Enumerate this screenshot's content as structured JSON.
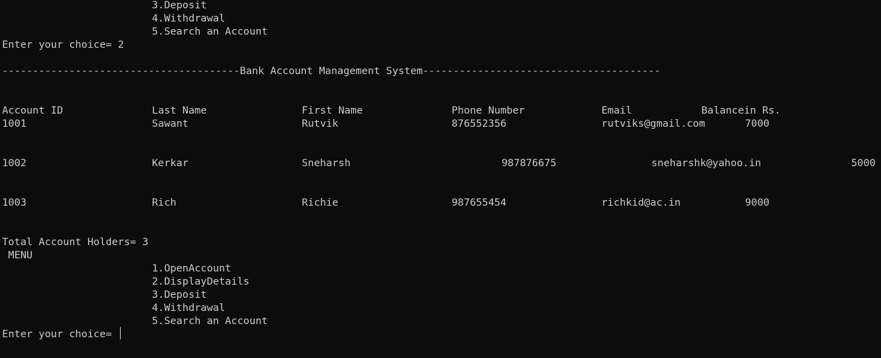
{
  "menu_top": {
    "items": [
      "3.Deposit",
      "4.Withdrawal",
      "5.Search an Account"
    ]
  },
  "prompt1": "Enter your choice= 2",
  "title_line": "---------------------------------------Bank Account Management System---------------------------------------",
  "table": {
    "headers": [
      "Account ID",
      "Last Name",
      "First Name",
      "Phone Number",
      "Email",
      "Balancein Rs."
    ],
    "rows": [
      [
        "1001",
        "Sawant",
        "Rutvik",
        "876552356",
        "rutviks@gmail.com",
        "7000"
      ],
      [
        "1002",
        "Kerkar",
        "Sneharsh",
        "987876675",
        "sneharshk@yahoo.in",
        "5000"
      ],
      [
        "1003",
        "Rich",
        "Richie",
        "987655454",
        "richkid@ac.in",
        "9000"
      ]
    ]
  },
  "total_line": "Total Account Holders= 3",
  "menu_title": " MENU",
  "menu_bottom": {
    "items": [
      "1.OpenAccount",
      "2.DisplayDetails",
      "3.Deposit",
      "4.Withdrawal",
      "5.Search an Account"
    ]
  },
  "prompt2": "Enter your choice= "
}
